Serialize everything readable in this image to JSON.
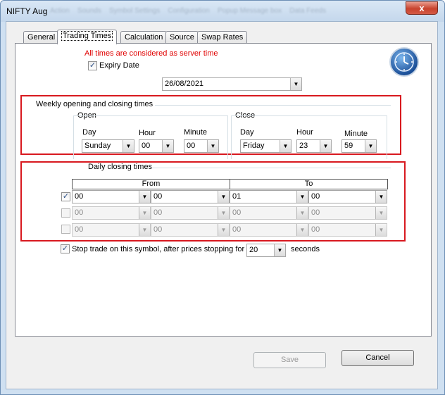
{
  "window": {
    "title": "NIFTY Aug",
    "blurred_tabs": [
      "Action",
      "Sounds",
      "Symbol Settings",
      "Configuration",
      "Popup Message box",
      "Data Feeds"
    ],
    "close_glyph": "x"
  },
  "tabs": [
    {
      "label": "General",
      "active": false
    },
    {
      "label": "Trading Times",
      "active": true
    },
    {
      "label": "Calculation",
      "active": false
    },
    {
      "label": "Source",
      "active": false
    },
    {
      "label": "Swap Rates",
      "active": false
    }
  ],
  "server_time_note": "All times are considered as server time",
  "expiry": {
    "label": "Expiry Date",
    "checked": true,
    "date": "26/08/2021"
  },
  "weekly": {
    "title": "Weekly opening and closing times",
    "open": {
      "label": "Open",
      "day_label": "Day",
      "hour_label": "Hour",
      "minute_label": "Minute",
      "day": "Sunday",
      "hour": "00",
      "minute": "00"
    },
    "close": {
      "label": "Close",
      "day_label": "Day",
      "hour_label": "Hour",
      "minute_label": "Minute",
      "day": "Friday",
      "hour": "23",
      "minute": "59"
    }
  },
  "daily": {
    "title": "Daily closing times",
    "from_label": "From",
    "to_label": "To",
    "rows": [
      {
        "checked": true,
        "from_h": "00",
        "from_m": "00",
        "to_h": "01",
        "to_m": "00"
      },
      {
        "checked": false,
        "from_h": "00",
        "from_m": "00",
        "to_h": "00",
        "to_m": "00"
      },
      {
        "checked": false,
        "from_h": "00",
        "from_m": "00",
        "to_h": "00",
        "to_m": "00"
      }
    ]
  },
  "stop_trade": {
    "checked": true,
    "label": "Stop trade on this symbol, after prices stopping for",
    "value": "20",
    "suffix": "seconds"
  },
  "buttons": {
    "save": "Save",
    "cancel": "Cancel"
  },
  "icons": {
    "clock": "clock-icon",
    "dropdown": "chevron-down-icon",
    "check": "checkmark-icon"
  }
}
